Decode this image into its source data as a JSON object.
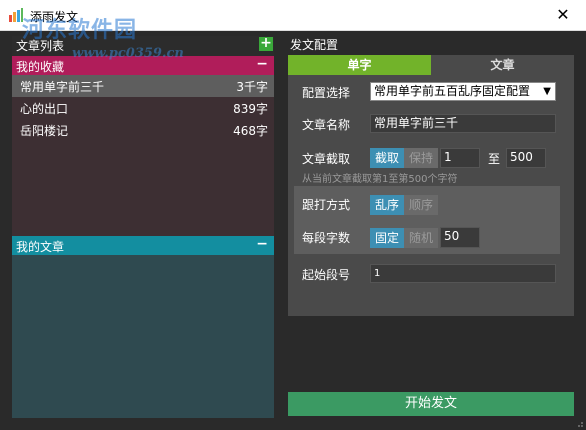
{
  "window": {
    "title": "添雨发文",
    "close_glyph": "✕",
    "watermark": "河东软件园",
    "watermark_url": "www.pc0359.cn"
  },
  "left": {
    "list_header": "文章列表",
    "favorites": {
      "label": "我的收藏",
      "items": [
        {
          "name": "常用单字前三千",
          "count": "3千字"
        },
        {
          "name": "心的出口",
          "count": "839字"
        },
        {
          "name": "岳阳楼记",
          "count": "468字"
        }
      ]
    },
    "articles": {
      "label": "我的文章"
    },
    "add_glyph": "+",
    "collapse_glyph": "−"
  },
  "right": {
    "title": "发文配置",
    "tabs": [
      "单字",
      "文章"
    ],
    "config_label": "配置选择",
    "config_value": "常用单字前五百乱序固定配置",
    "name_label": "文章名称",
    "name_value": "常用单字前三千",
    "cut_label": "文章截取",
    "cut_on": "截取",
    "cut_off": "保持",
    "cut_from": "1",
    "cut_to_label": "至",
    "cut_to": "500",
    "hint": "从当前文章截取第1至第500个字符",
    "shuffle_label": "跟打方式",
    "shuffle_on": "乱序",
    "shuffle_off": "顺序",
    "per_label": "每段字数",
    "per_on": "固定",
    "per_off": "随机",
    "per_value": "50",
    "start_label": "起始段号",
    "start_value": "1"
  },
  "start_button": "开始发文"
}
